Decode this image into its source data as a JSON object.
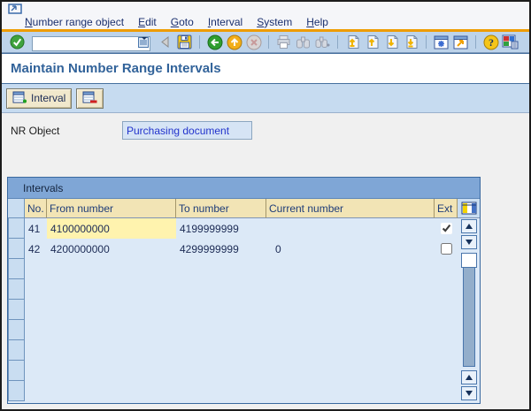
{
  "menubar": {
    "items": [
      {
        "u": "N",
        "rest": "umber range object"
      },
      {
        "u": "E",
        "rest": "dit"
      },
      {
        "u": "G",
        "rest": "oto"
      },
      {
        "u": "I",
        "rest": "nterval"
      },
      {
        "u": "S",
        "rest": "ystem"
      },
      {
        "u": "H",
        "rest": "elp"
      }
    ]
  },
  "toolbar": {
    "command_value": "",
    "icon_names": [
      "enter",
      "command-field",
      "history-dropdown",
      "back-triangle",
      "save",
      "back",
      "exit",
      "cancel",
      "print",
      "find",
      "find-next",
      "first-page",
      "page-up",
      "page-down",
      "last-page",
      "new-session",
      "create-shortcut",
      "help",
      "customize-layout"
    ],
    "help_glyph": "?"
  },
  "header": {
    "title": "Maintain Number Range Intervals"
  },
  "app_toolbar": {
    "interval_button_label": "Interval"
  },
  "form": {
    "nr_object_label": "NR Object",
    "nr_object_value": "Purchasing document"
  },
  "table": {
    "group_title": "Intervals",
    "columns": {
      "no": "No.",
      "from": "From number",
      "to": "To number",
      "current": "Current number",
      "ext": "Ext"
    },
    "rows": [
      {
        "no": "41",
        "from": "4100000000",
        "to": "4199999999",
        "current": "",
        "ext_checked": true,
        "from_highlighted": true
      },
      {
        "no": "42",
        "from": "4200000000",
        "to": "4299999999",
        "current": "0",
        "ext_checked": false,
        "from_highlighted": false
      }
    ]
  },
  "colors": {
    "accent_orange": "#EE9C00",
    "toolbar_blue": "#BDD3EA",
    "app_toolbar_blue": "#C6DBF0",
    "column_header_tan": "#F2E4B5",
    "highlight_yellow": "#FFF3AE",
    "group_header_blue": "#7FA6D6",
    "table_body_blue": "#DCE9F7",
    "title_blue": "#32639A",
    "field_blue": "#D6E4F5"
  }
}
